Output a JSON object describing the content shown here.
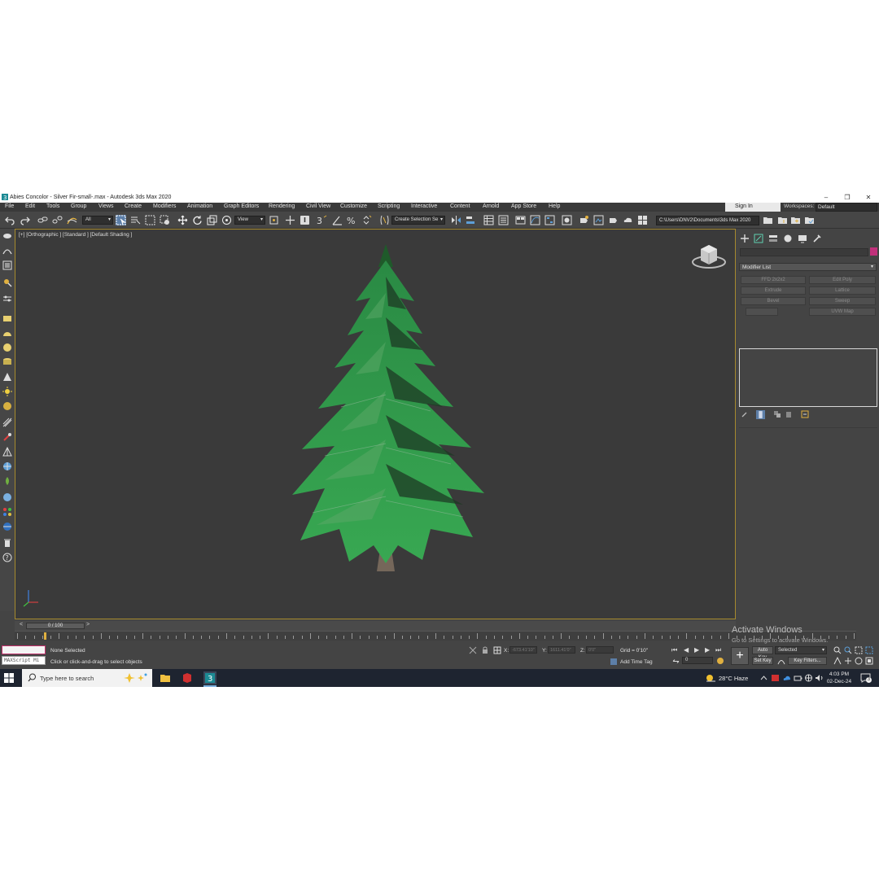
{
  "window": {
    "title": "Abies Concolor - Silver Fir-small-.max - Autodesk 3ds Max 2020",
    "controls": [
      "–",
      "❐",
      "✕"
    ]
  },
  "menu": {
    "items": [
      "File",
      "Edit",
      "Tools",
      "Group",
      "Views",
      "Create",
      "Modifiers",
      "Animation",
      "Graph Editors",
      "Rendering",
      "Civil View",
      "Customize",
      "Scripting",
      "Interactive",
      "Content",
      "Arnold",
      "App Store",
      "Help"
    ],
    "sign_in": "Sign In",
    "workspaces_label": "Workspaces:",
    "workspace_value": "Default"
  },
  "toolbar": {
    "selection_filter": "All",
    "reference_coord": "View",
    "named_selection": "Create Selection Se",
    "project_path": "C:\\Users\\DNV2\\Documents\\3ds Max 2020"
  },
  "viewport": {
    "label": "[+] [Orthographic ] [Standard ] [Default Shading ]"
  },
  "command_panel": {
    "modifier_list": "Modifier List",
    "buttons": [
      "FFD 2x2x2",
      "Edit Poly",
      "Extrude",
      "Lattice",
      "Bevel",
      "Sweep",
      "",
      "UVW Map"
    ]
  },
  "timeline": {
    "slider": "0 / 100",
    "prev": "<",
    "next": ">"
  },
  "status": {
    "maxscript": "MAXScript Mi",
    "selection": "None Selected",
    "prompt": "Click or click-and-drag to select objects",
    "x_label": "X:",
    "x_value": "-673.41'10\"",
    "y_label": "Y:",
    "y_value": "1611.41'0\"",
    "z_label": "Z:",
    "z_value": "0'0\"",
    "grid": "Grid = 0'10\"",
    "add_time_tag": "Add Time Tag",
    "frame": "0",
    "auto_key": "Auto Key",
    "set_key": "Set Key",
    "key_mode": "Selected",
    "key_filters": "Key Filters..."
  },
  "watermark": {
    "line1": "Activate Windows",
    "line2": "Go to Settings to activate Windows."
  },
  "taskbar": {
    "search_placeholder": "Type here to search",
    "weather": "28°C  Haze",
    "time": "4:03 PM",
    "date": "02-Dec-24",
    "notifications": "3"
  },
  "colors": {
    "accent_viewport_border": "#a68a2e",
    "object_color": "#c0307a",
    "foliage": "#2e9a4a"
  }
}
